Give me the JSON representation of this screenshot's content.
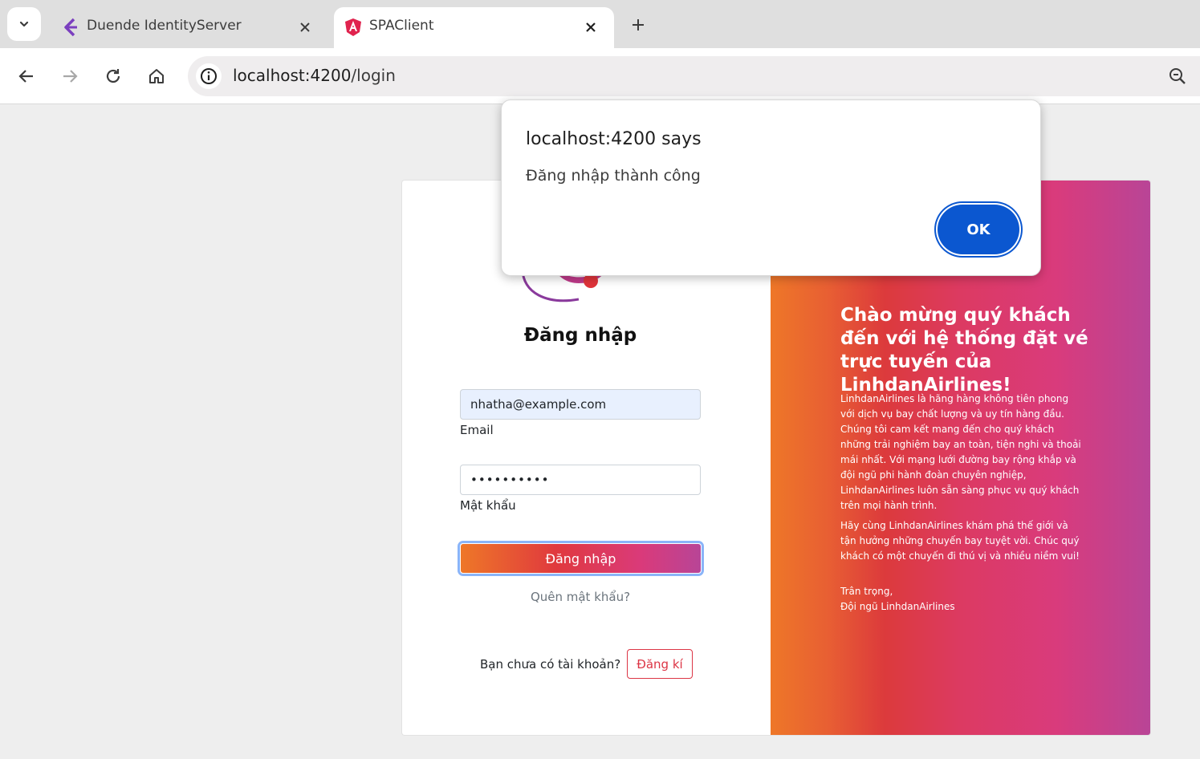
{
  "browser": {
    "tabs": [
      {
        "title": "Duende IdentityServer",
        "icon": "duende-logo-icon",
        "active": false
      },
      {
        "title": "SPAClient",
        "icon": "angular-logo-icon",
        "active": true
      }
    ],
    "url_host": "localhost:4200",
    "url_path": "/login"
  },
  "dialog": {
    "title": "localhost:4200 says",
    "message": "Đăng nhập thành công",
    "ok_label": "OK"
  },
  "login": {
    "title": "Đăng nhập",
    "email_value": "nhatha@example.com",
    "email_label": "Email",
    "password_value": "••••••••••",
    "password_label": "Mật khẩu",
    "submit_label": "Đăng nhập",
    "forgot_label": "Quên mật khẩu?",
    "no_account_text": "Bạn chưa có tài khoản?",
    "signup_label": "Đăng kí"
  },
  "welcome": {
    "title": "Chào mừng quý khách đến với hệ thống đặt vé trực tuyến của LinhdanAirlines!",
    "paragraph1": "LinhdanAirlines là hãng hàng không tiên phong với dịch vụ bay chất lượng và uy tín hàng đầu. Chúng tôi cam kết mang đến cho quý khách những trải nghiệm bay an toàn, tiện nghi và thoải mái nhất. Với mạng lưới đường bay rộng khắp và đội ngũ phi hành đoàn chuyên nghiệp, LinhdanAirlines luôn sẵn sàng phục vụ quý khách trên mọi hành trình.",
    "paragraph2": "Hãy cùng LinhdanAirlines khám phá thế giới và tận hưởng những chuyến bay tuyệt vời. Chúc quý khách có một chuyến đi thú vị và nhiều niềm vui!",
    "sign_off": "Trân trọng,",
    "signature": "Đội ngũ LinhdanAirlines"
  },
  "colors": {
    "accent_orange": "#ee7728",
    "accent_red": "#dc3a3c",
    "accent_pink": "#d93b7c",
    "accent_purple": "#b84597",
    "dialog_button": "#0b57d0",
    "signup_red": "#dc3545"
  }
}
